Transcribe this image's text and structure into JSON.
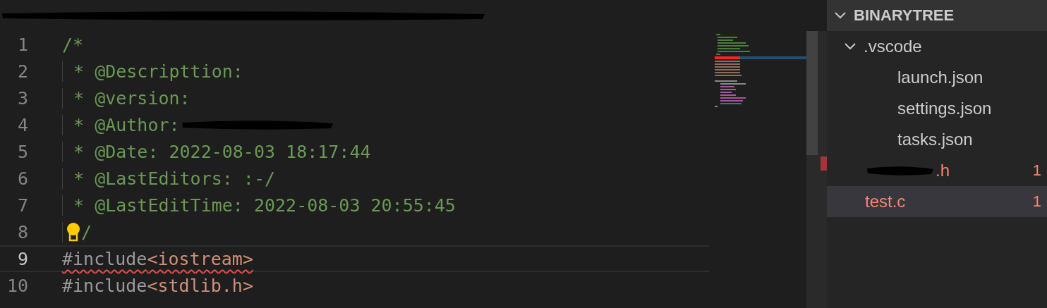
{
  "editor": {
    "lines": [
      {
        "number": "1",
        "tokens": [
          {
            "kind": "comment",
            "text": "/*"
          }
        ]
      },
      {
        "number": "2",
        "tokens": [
          {
            "kind": "comment",
            "text": " * @Descripttion:"
          }
        ]
      },
      {
        "number": "3",
        "tokens": [
          {
            "kind": "comment",
            "text": " * @version:"
          }
        ]
      },
      {
        "number": "4",
        "tokens": [
          {
            "kind": "comment",
            "text": " * @Author:"
          }
        ],
        "redacted": true
      },
      {
        "number": "5",
        "tokens": [
          {
            "kind": "comment",
            "text": " * @Date: 2022-08-03 18:17:44"
          }
        ]
      },
      {
        "number": "6",
        "tokens": [
          {
            "kind": "comment",
            "text": " * @LastEditors: :-/"
          }
        ]
      },
      {
        "number": "7",
        "tokens": [
          {
            "kind": "comment",
            "text": " * @LastEditTime: 2022-08-03 20:55:45"
          }
        ]
      },
      {
        "number": "8",
        "tokens": [
          {
            "kind": "comment",
            "text": "/"
          }
        ],
        "lightbulb": true
      },
      {
        "number": "9",
        "tokens": [
          {
            "kind": "directive",
            "text": "#include"
          },
          {
            "kind": "string",
            "text": "<iostream>"
          }
        ],
        "current": true,
        "error": true
      },
      {
        "number": "10",
        "tokens": [
          {
            "kind": "directive",
            "text": "#include"
          },
          {
            "kind": "string",
            "text": "<stdlib.h>"
          }
        ]
      }
    ]
  },
  "explorer": {
    "title": "BINARYTREE",
    "expanded": true,
    "items": [
      {
        "label": ".vscode",
        "kind": "folder",
        "expanded": true,
        "selected": false,
        "error": false,
        "children": [
          {
            "label": "launch.json",
            "kind": "file",
            "selected": false,
            "error": false
          },
          {
            "label": "settings.json",
            "kind": "file",
            "selected": false,
            "error": false
          },
          {
            "label": "tasks.json",
            "kind": "file",
            "selected": false,
            "error": false
          }
        ]
      },
      {
        "label": ".h",
        "kind": "file",
        "redacted": true,
        "selected": false,
        "error": true,
        "badge": "1"
      },
      {
        "label": "test.c",
        "kind": "file",
        "selected": true,
        "error": true,
        "badge": "1"
      }
    ]
  }
}
